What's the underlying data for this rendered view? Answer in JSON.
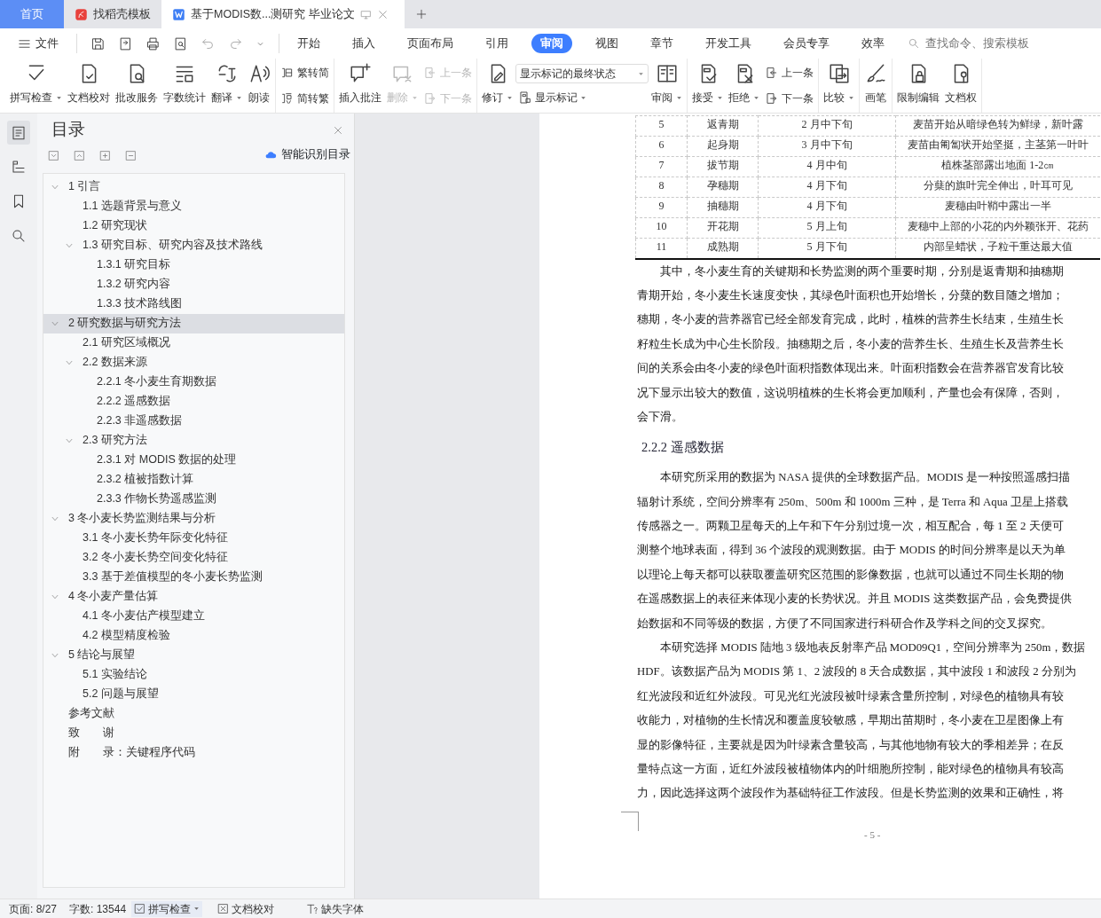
{
  "tabs": [
    {
      "label": "首页",
      "kind": "home",
      "selected": false
    },
    {
      "label": "找稻壳模板",
      "kind": "app",
      "selected": false
    },
    {
      "label": "基于MODIS数...测研究 毕业论文",
      "kind": "doc",
      "selected": true
    }
  ],
  "menu": {
    "file": "文件",
    "items": [
      {
        "label": "开始",
        "selected": false
      },
      {
        "label": "插入",
        "selected": false
      },
      {
        "label": "页面布局",
        "selected": false
      },
      {
        "label": "引用",
        "selected": false
      },
      {
        "label": "审阅",
        "selected": true
      },
      {
        "label": "视图",
        "selected": false
      },
      {
        "label": "章节",
        "selected": false
      },
      {
        "label": "开发工具",
        "selected": false
      },
      {
        "label": "会员专享",
        "selected": false
      },
      {
        "label": "效率",
        "selected": false
      }
    ],
    "search": {
      "placeholder": "查找命令、搜索模板"
    }
  },
  "ribbon": [
    [
      {
        "kind": "large",
        "label": "拼写检查",
        "caret": true,
        "disabled": false
      },
      {
        "kind": "large",
        "label": "文档校对",
        "caret": false,
        "disabled": false
      },
      {
        "kind": "large",
        "label": "批改服务",
        "caret": false,
        "disabled": false
      },
      {
        "kind": "large",
        "label": "字数统计",
        "caret": false,
        "disabled": false
      },
      {
        "kind": "large",
        "label": "翻译",
        "caret": true,
        "disabled": false
      },
      {
        "kind": "large",
        "label": "朗读",
        "caret": false,
        "disabled": false
      }
    ],
    [
      {
        "kind": "pair",
        "items": [
          {
            "label": "繁转简",
            "disabled": false
          },
          {
            "label": "简转繁",
            "disabled": false
          }
        ]
      }
    ],
    [
      {
        "kind": "large",
        "label": "插入批注",
        "caret": false,
        "disabled": false
      },
      {
        "kind": "large",
        "label": "删除",
        "caret": true,
        "disabled": true
      },
      {
        "kind": "pair",
        "items": [
          {
            "label": "上一条",
            "disabled": true
          },
          {
            "label": "下一条",
            "disabled": true
          }
        ]
      }
    ],
    [
      {
        "kind": "large",
        "label": "修订",
        "caret": true,
        "disabled": false
      },
      {
        "kind": "select",
        "value": "显示标记的最终状态",
        "below": {
          "label": "显示标记",
          "caret": true
        }
      },
      {
        "kind": "large",
        "label": "审阅",
        "caret": true,
        "disabled": false
      }
    ],
    [
      {
        "kind": "large",
        "label": "接受",
        "caret": true,
        "disabled": false
      },
      {
        "kind": "large",
        "label": "拒绝",
        "caret": true,
        "disabled": false
      },
      {
        "kind": "pair",
        "items": [
          {
            "label": "上一条",
            "disabled": false
          },
          {
            "label": "下一条",
            "disabled": false
          }
        ]
      }
    ],
    [
      {
        "kind": "large",
        "label": "比较",
        "caret": true,
        "disabled": false
      }
    ],
    [
      {
        "kind": "large",
        "label": "画笔",
        "caret": false,
        "disabled": false
      }
    ],
    [
      {
        "kind": "large",
        "label": "限制编辑",
        "caret": false,
        "disabled": false
      },
      {
        "kind": "large",
        "label": "文档权",
        "caret": false,
        "disabled": false
      }
    ]
  ],
  "toc": {
    "title": "目录",
    "smart": "智能识别目录",
    "items": [
      {
        "label": "1 引言",
        "selected": false,
        "expanded": true,
        "children": [
          {
            "label": "1.1 选题背景与意义",
            "selected": false
          },
          {
            "label": "1.2 研究现状",
            "selected": false
          },
          {
            "label": "1.3 研究目标、研究内容及技术路线",
            "selected": false,
            "expanded": true,
            "children": [
              {
                "label": "1.3.1 研究目标",
                "selected": false
              },
              {
                "label": "1.3.2 研究内容",
                "selected": false
              },
              {
                "label": "1.3.3 技术路线图",
                "selected": false
              }
            ]
          }
        ]
      },
      {
        "label": "2 研究数据与研究方法",
        "selected": true,
        "expanded": true,
        "children": [
          {
            "label": "2.1 研究区域概况",
            "selected": false
          },
          {
            "label": "2.2 数据来源",
            "selected": false,
            "expanded": true,
            "children": [
              {
                "label": "2.2.1 冬小麦生育期数据",
                "selected": false
              },
              {
                "label": "2.2.2 遥感数据",
                "selected": false
              },
              {
                "label": "2.2.3 非遥感数据",
                "selected": false
              }
            ]
          },
          {
            "label": "2.3 研究方法",
            "selected": false,
            "expanded": true,
            "children": [
              {
                "label": "2.3.1 对 MODIS 数据的处理",
                "selected": false
              },
              {
                "label": "2.3.2 植被指数计算",
                "selected": false
              },
              {
                "label": "2.3.3 作物长势遥感监测",
                "selected": false
              }
            ]
          }
        ]
      },
      {
        "label": "3 冬小麦长势监测结果与分析",
        "selected": false,
        "expanded": true,
        "children": [
          {
            "label": "3.1 冬小麦长势年际变化特征",
            "selected": false
          },
          {
            "label": "3.2 冬小麦长势空间变化特征",
            "selected": false
          },
          {
            "label": "3.3 基于差值模型的冬小麦长势监测",
            "selected": false
          }
        ]
      },
      {
        "label": "4 冬小麦产量估算",
        "selected": false,
        "expanded": true,
        "children": [
          {
            "label": "4.1 冬小麦估产模型建立",
            "selected": false
          },
          {
            "label": "4.2 模型精度检验",
            "selected": false
          }
        ]
      },
      {
        "label": "5 结论与展望",
        "selected": false,
        "expanded": true,
        "children": [
          {
            "label": "5.1 实验结论",
            "selected": false
          },
          {
            "label": "5.2 问题与展望",
            "selected": false
          }
        ]
      },
      {
        "label": "参考文献",
        "selected": false
      },
      {
        "label": "致　　谢",
        "selected": false
      },
      {
        "label": "附　　录：关键程序代码",
        "selected": false
      }
    ]
  },
  "document": {
    "table": {
      "rows": [
        [
          "5",
          "返青期",
          "2 月中下旬",
          "麦苗开始从暗绿色转为鲜绿，新叶露"
        ],
        [
          "6",
          "起身期",
          "3 月中下旬",
          "麦苗由匍匐状开始坚挺，主茎第一叶叶"
        ],
        [
          "7",
          "拔节期",
          "4 月中旬",
          "植株茎部露出地面 1-2㎝"
        ],
        [
          "8",
          "孕穗期",
          "4 月下旬",
          "分蘖的旗叶完全伸出，叶耳可见"
        ],
        [
          "9",
          "抽穗期",
          "4 月下旬",
          "麦穗由叶鞘中露出一半"
        ],
        [
          "10",
          "开花期",
          "5 月上旬",
          "麦穗中上部的小花的内外颖张开、花药"
        ],
        [
          "11",
          "成熟期",
          "5 月下旬",
          "内部呈蜡状，子粒干重达最大值"
        ]
      ]
    },
    "blocks": [
      {
        "kind": "paragraph",
        "lines": [
          "其中，冬小麦生育的关键期和长势监测的两个重要时期，分别是返青期和抽穗期",
          "青期开始，冬小麦生长速度变快，其绿色叶面积也开始增长，分蘖的数目随之增加；",
          "穗期，冬小麦的营养器官已经全部发育完成，此时，植株的营养生长结束，生殖生长",
          "籽粒生长成为中心生长阶段。抽穗期之后，冬小麦的营养生长、生殖生长及营养生长",
          "间的关系会由冬小麦的绿色叶面积指数体现出来。叶面积指数会在营养器官发育比较",
          "况下显示出较大的数值，这说明植株的生长将会更加顺利，产量也会有保障，否则，",
          "会下滑。"
        ]
      },
      {
        "kind": "heading",
        "text": "2.2.2  遥感数据"
      },
      {
        "kind": "paragraph",
        "lines": [
          "本研究所采用的数据为 NASA 提供的全球数据产品。MODIS 是一种按照遥感扫描",
          "辐射计系统，空间分辨率有 250m、500m 和 1000m 三种，是 Terra 和 Aqua 卫星上搭载",
          "传感器之一。两颗卫星每天的上午和下午分别过境一次，相互配合，每 1 至 2 天便可",
          "测整个地球表面，得到 36 个波段的观测数据。由于 MODIS 的时间分辨率是以天为单",
          "以理论上每天都可以获取覆盖研究区范围的影像数据，也就可以通过不同生长期的物",
          "在遥感数据上的表征来体现小麦的长势状况。并且 MODIS 这类数据产品，会免费提供",
          "始数据和不同等级的数据，方便了不同国家进行科研合作及学科之间的交叉探究。"
        ]
      },
      {
        "kind": "paragraph",
        "lines": [
          "本研究选择 MODIS 陆地 3 级地表反射率产品 MOD09Q1，空间分辨率为 250m，数据",
          "HDF。该数据产品为 MODIS 第 1、2 波段的 8 天合成数据，其中波段 1 和波段 2 分别为",
          "红光波段和近红外波段。可见光红光波段被叶绿素含量所控制，对绿色的植物具有较",
          "收能力，对植物的生长情况和覆盖度较敏感，早期出苗期时，冬小麦在卫星图像上有",
          "显的影像特征，主要就是因为叶绿素含量较高，与其他地物有较大的季相差异；在反",
          "量特点这一方面，近红外波段被植物体内的叶细胞所控制，能对绿色的植物具有较高",
          "力，因此选择这两个波段作为基础特征工作波段。但是长势监测的效果和正确性，将"
        ]
      }
    ],
    "page_number": "- 5 -"
  },
  "status_bar": {
    "page": "页面: 8/27",
    "words": "字数: 13544",
    "spell": "拼写检查",
    "proof": "文档校对",
    "fonts": "缺失字体"
  }
}
